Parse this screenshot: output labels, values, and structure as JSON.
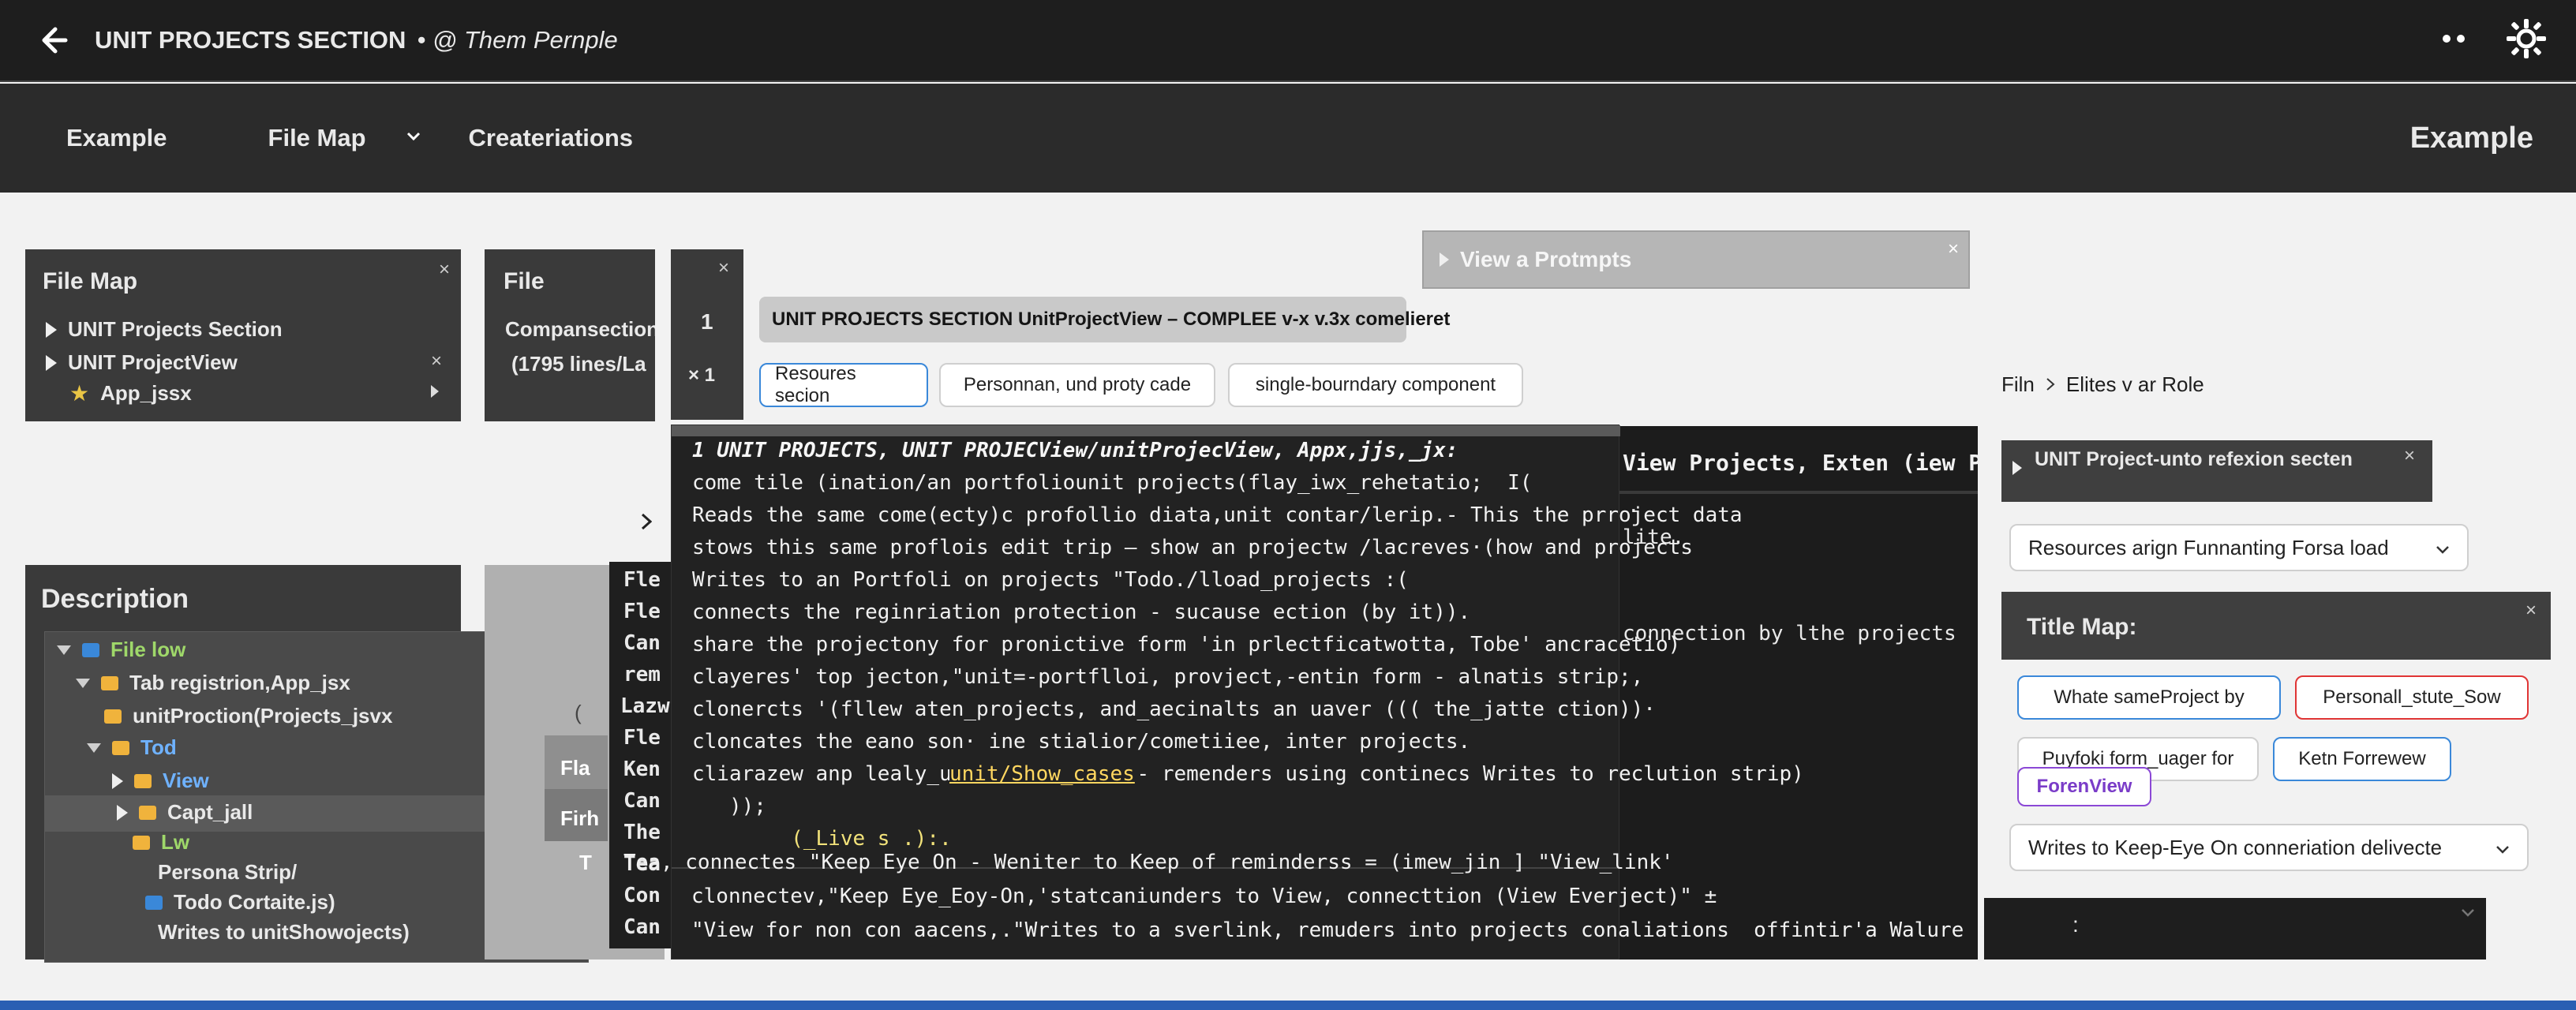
{
  "header": {
    "title": "UNIT PROJECTS SECTION",
    "subtitle": "• @ Them Pernple",
    "icons": [
      "back-arrow-icon",
      "more-icon",
      "settings-icon"
    ]
  },
  "nav": {
    "items": [
      "Example",
      "File Map",
      "Createriations"
    ],
    "right_label": "Example"
  },
  "filemap_panel": {
    "title": "File Map",
    "items": [
      "UNIT Projects Section",
      "UNIT ProjectView",
      "App_jssx"
    ]
  },
  "file_panel": {
    "title": "File",
    "line1": "Compansection",
    "line2": "(1795 lines/La"
  },
  "counter_panel": {
    "a": "1",
    "b": "× 1"
  },
  "prompts_bar": {
    "label": "View a Protmpts"
  },
  "project_pill": {
    "label": "UNIT PROJECTS SECTION UnitProjectView – COMPLEE v-x v.3x comelieret"
  },
  "chips_top": [
    "Resoures secion",
    "Personnan, und proty cade",
    "single-bourndary component"
  ],
  "breadcrumb": {
    "a": "Filn",
    "b": "Elites v ar Role"
  },
  "description_panel": {
    "title": "Description",
    "tree": [
      "File low",
      "Tab registrion,App_jsx",
      "unitProction(Projects_jsvx",
      "Tod",
      "View",
      "Capt_jall",
      "Lw",
      "Persona Strip/",
      "Todo Cortaite.js)",
      "Writes to unitShowojects)"
    ]
  },
  "mid_labels": {
    "fla": "Fla",
    "fir": "Firh",
    "t": "T",
    "paren": "("
  },
  "left_code_column": [
    "Fle",
    "Fle",
    "Can",
    "rem",
    "Lazw",
    "Fle",
    "Ken",
    "Can",
    "The",
    "Tea",
    "Con",
    "Can"
  ],
  "code_popup": {
    "header": "1 UNIT PROJECTS, UNIT PROJECView/unitProjecView, Appx,jjs,_jx:",
    "lines": [
      "come tile (ination/an portfoliounit projects(flay_iwx_rehetatio;  I(",
      "Reads the same come(ecty)c profollio diata,unit contar/lerip.- This the prroject data",
      "stows this same proflois edit trip — show an projectw /lacreves·(how and projects",
      "Writes to an Portfoli on projects \"Todo./lload_projects :(",
      "connects the reginriation protection - sucause ection (by it)).",
      "share the projectony for pronictive form 'in prlectficatwotta, Tobe' ancracetio)",
      "clayeres' top jecton,\"unit=-portflloi, provject,-entin form - alnatis strip;,",
      "clonercts '(fllew aten_projects, and_aecinalts an uaver ((( the_jatte ction))·",
      "cloncates the eano son· ine stialior/cometiiee, inter projects.",
      "cliarazew anp lealy_unit/Show_cases - remenders using continecs Writes to reclution strip)",
      "   ));",
      "        (_Live s .):."
    ],
    "unit_highlight": "unit/Show_cases"
  },
  "code_bottom": [
    "Tea, connectes \"Keep Eye On - Weniter to Keep of reminderss = (imew_jin ] \"View_link'",
    "clonnectev,\"Keep Eye_Eoy-On,'statcaniunders to View, connecttion (View Everject)\" ±",
    "\"View for non con aacens,.\"Writes to a sverlink, remuders into projects conaliations  offintir'a Walure projects"
  ],
  "right_code": {
    "header": "View Projects, Exten (iew Pr jé) W",
    "dot": ".",
    "line1": "lite.",
    "line2": "connection by lthe projects"
  },
  "right_panel": {
    "header_label": "UNIT Project-unto refexion secten",
    "select1": "Resources arign Funnanting Forsa load",
    "title_map": "Title Map:",
    "chips": [
      "Whate sameProject by",
      "Personall_stute_Sow",
      "Puyfoki form_uager for",
      "Ketn Forrewew",
      "ForenView"
    ],
    "select2": "Writes to Keep-Eye On  conneriation delivecte",
    "bottom_label": ":"
  }
}
